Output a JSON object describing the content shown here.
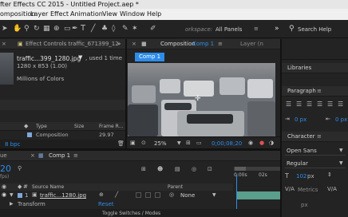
{
  "titlebar": {
    "title": "fter Effects CC 2015 - Untitled Project.aep *"
  },
  "menu": [
    "omposition",
    "Layer",
    "Effect",
    "Animation",
    "View",
    "Window",
    "Help"
  ],
  "toolbar": {
    "workspace_label": "orkspace:",
    "workspace_value": "All Panels",
    "search_label": "Search Help"
  },
  "project_panel": {
    "tab_label": "Effect Controls traffic_671399_12",
    "item_name": "traffic...399_1280.jpg",
    "item_used": ", used 1 time",
    "item_dims": "1280 x 853 (1.00)",
    "item_colors": "Millions of Colors",
    "columns": [
      "Type",
      "Size",
      "Frame R..."
    ],
    "row": {
      "name": "",
      "type": "Composition",
      "size": "",
      "frame_rate": "29.97"
    },
    "bpc": "8 bpc"
  },
  "composition_panel": {
    "tab_label": "Composition",
    "tab_name": "Comp 1",
    "layer_tab": "Layer  (n",
    "comp_chip": "Comp 1",
    "zoom": "25%",
    "timecode": "0;00;08;20"
  },
  "right_panels": {
    "libraries": "Libraries",
    "paragraph": "Paragraph",
    "px_left": "0 px",
    "px_right": "0 px",
    "character": "Character",
    "font_family": "Open Sans",
    "font_style": "Regular",
    "font_size": "102",
    "font_size_unit": "px",
    "metrics": "Metrics",
    "leading_unit": "px"
  },
  "timeline": {
    "left_tab": "ue",
    "tab_label": "Comp 1",
    "current_time": "20",
    "fps": "fps)",
    "ruler_start": "0:00s",
    "ruler_mark": "02s",
    "col_source_name": "Source Name",
    "col_parent": "Parent",
    "layer_index": "1",
    "layer_name": "traffic...1280.jpg",
    "parent_value": "None",
    "transform_label": "Transform",
    "reset_label": "Reset",
    "toggle_label": "Toggle Switches / Modes"
  },
  "colors": {
    "accent": "#2d8ceb",
    "layer_bar": "#5a9e8c",
    "label_chip": "#7fa7d8"
  }
}
